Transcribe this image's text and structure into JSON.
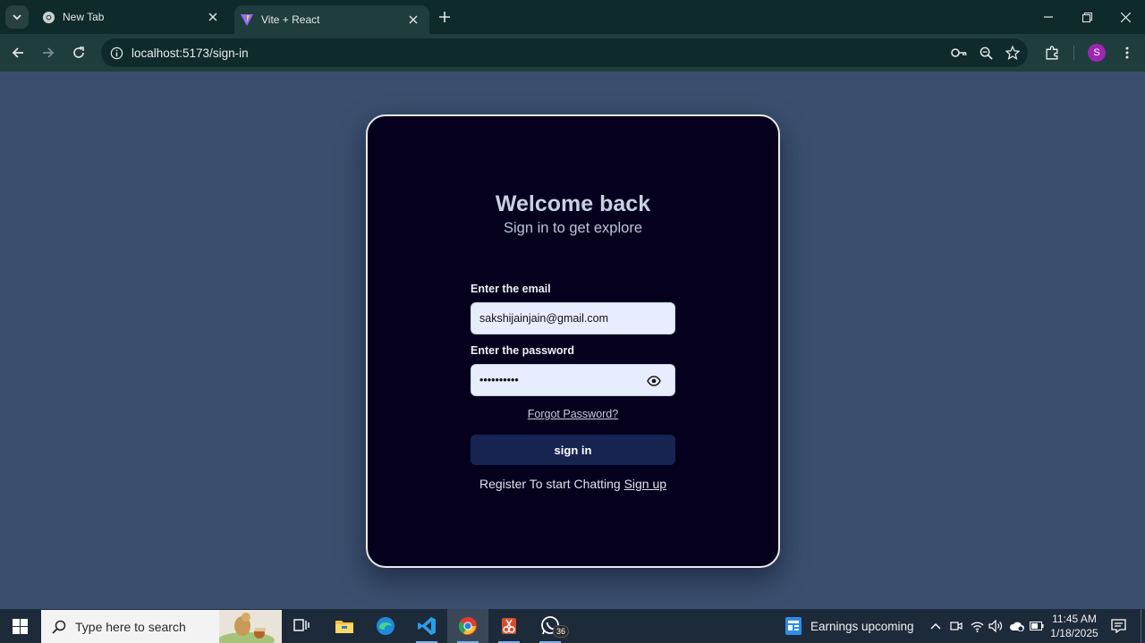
{
  "browser": {
    "tabs": [
      {
        "title": "New Tab",
        "favicon": "chrome-icon"
      },
      {
        "title": "Vite + React",
        "favicon": "vite-icon"
      }
    ],
    "url": "localhost:5173/sign-in",
    "profile_initial": "S"
  },
  "signin": {
    "heading": "Welcome back",
    "subheading": "Sign in to get explore",
    "email_label": "Enter the email",
    "email_value": "sakshijainjain@gmail.com",
    "password_label": "Enter the password",
    "password_value": "••••••••••",
    "forgot_link": "Forgot Password?",
    "submit_label": "sign in",
    "register_text": "Register To start Chatting",
    "register_link": "Sign up"
  },
  "taskbar": {
    "search_placeholder": "Type here to search",
    "whatsapp_badge": "36",
    "news_text": "Earnings upcoming",
    "time": "11:45 AM",
    "date": "1/18/2025"
  },
  "colors": {
    "page_bg": "#3a4f6e",
    "card_bg": "#05001d",
    "button_bg": "#172452",
    "input_bg": "#e8edfd"
  }
}
